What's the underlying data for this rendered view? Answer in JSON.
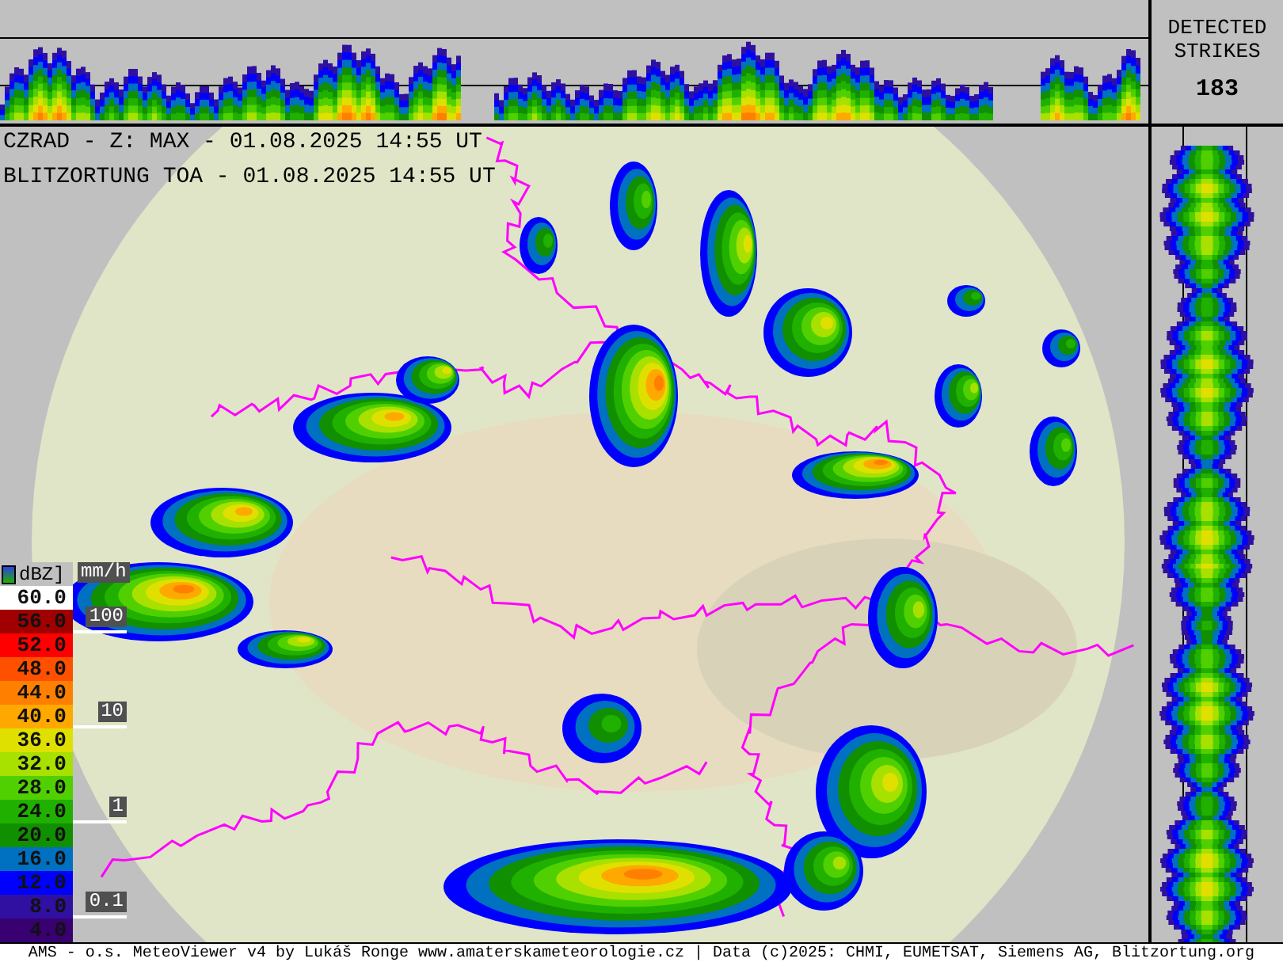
{
  "strikes": {
    "label": "DETECTED STRIKES",
    "count": "183"
  },
  "map": {
    "titles": [
      "CZRAD - Z: MAX - 01.08.2025 14:55 UT",
      "BLITZORTUNG TOA - 01.08.2025 14:55 UT"
    ]
  },
  "legend": {
    "unit": "dBZ]",
    "rain_unit": "mm/h",
    "levels": [
      {
        "label": "60.0",
        "color": "#ffffff"
      },
      {
        "label": "56.0",
        "color": "#a00000"
      },
      {
        "label": "52.0",
        "color": "#ff0000"
      },
      {
        "label": "48.0",
        "color": "#ff5000"
      },
      {
        "label": "44.0",
        "color": "#ff8000"
      },
      {
        "label": "40.0",
        "color": "#ffa800"
      },
      {
        "label": "36.0",
        "color": "#e0e000"
      },
      {
        "label": "32.0",
        "color": "#a8e000"
      },
      {
        "label": "28.0",
        "color": "#50d000"
      },
      {
        "label": "24.0",
        "color": "#20b000"
      },
      {
        "label": "20.0",
        "color": "#109000"
      },
      {
        "label": "16.0",
        "color": "#0070c0"
      },
      {
        "label": "12.0",
        "color": "#0000ff"
      },
      {
        "label": "8.0",
        "color": "#3010a0"
      },
      {
        "label": "4.0",
        "color": "#380070"
      }
    ],
    "rain_marks": [
      "100",
      "10",
      "1",
      "0.1"
    ]
  },
  "footer": "AMS - o.s. MeteoViewer v4 by Lukáš Ronge www.amaterskameteorologie.cz | Data (c)2025: CHMI, EUMETSAT, Siemens AG, Blitzortung.org"
}
